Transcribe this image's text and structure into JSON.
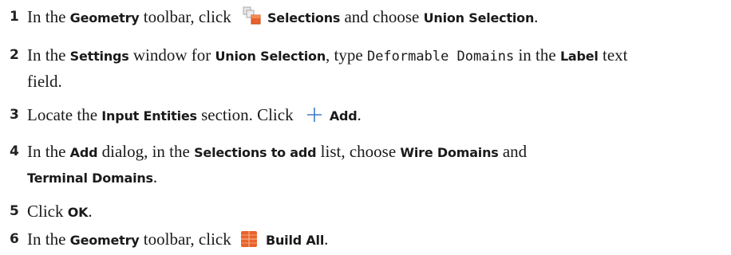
{
  "steps": [
    {
      "number": "1",
      "parts": [
        "In the ",
        "Geometry",
        " toolbar, click ",
        "Selections",
        " and choose ",
        "Union Selection",
        "."
      ]
    },
    {
      "number": "2",
      "parts": [
        "In the ",
        "Settings",
        " window for ",
        "Union Selection",
        ", type ",
        "Deformable Domains",
        " in the ",
        "Label",
        " text",
        "field."
      ]
    },
    {
      "number": "3",
      "parts": [
        "Locate the ",
        "Input Entities",
        " section. Click ",
        "Add",
        "."
      ]
    },
    {
      "number": "4",
      "parts": [
        "In the ",
        "Add",
        " dialog, in the ",
        "Selections to add",
        " list, choose ",
        "Wire Domains",
        " and",
        "Terminal Domains",
        "."
      ]
    },
    {
      "number": "5",
      "parts": [
        "Click ",
        "OK",
        "."
      ]
    },
    {
      "number": "6",
      "parts": [
        "In the ",
        "Geometry",
        " toolbar, click ",
        "Build All",
        "."
      ]
    }
  ],
  "icons": {
    "selections": "selections-icon",
    "add": "plus-icon",
    "build_all": "build-all-icon"
  },
  "colors": {
    "text": "#1a1a1a",
    "selections_icon_orange": "#e8632b",
    "selections_icon_gray": "#a8a8a8",
    "plus_icon": "#3b7dc4",
    "build_all_icon": "#e8632b"
  }
}
